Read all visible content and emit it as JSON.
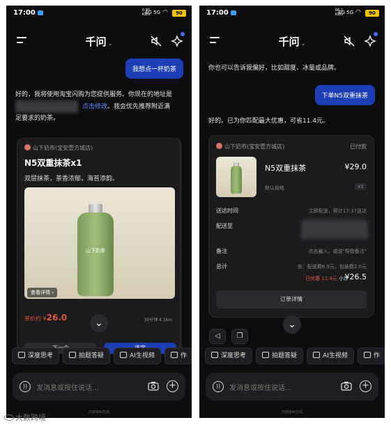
{
  "status_left": {
    "time": "17:00",
    "speed_value": "0.80",
    "speed_unit": "KB/s",
    "network": "4G 5G",
    "battery": "90"
  },
  "status_right": {
    "time": "17:00",
    "speed_value": "68.2",
    "speed_unit": "KB/s",
    "network": "4G 5G",
    "battery": "90"
  },
  "app_title": "千问",
  "left": {
    "user_message": "我想点一杯奶茶",
    "ai_line1": "好的，我将使用淘宝闪购为您提供服务。你现在的地址是",
    "ai_link": "点击修改",
    "ai_line2_tail": "。我会优先推荐附近满",
    "ai_line3": "足要求的奶茶。",
    "card": {
      "shop": "山下奶市(宝安壹方城店)",
      "product": "N5双重抹茶x1",
      "description": "双层抹茶，茶香浓郁，海苔添韵。",
      "bottle_text": "山下奶茶",
      "view_detail": "查看详情 ›",
      "price_prefix": "单价约 ¥",
      "price": "26.0",
      "eta": "30分钟 4.1km",
      "next_button": "下一个",
      "order_button": "选定"
    }
  },
  "right": {
    "ai_top": "你也可以告诉我偏好，比如甜度、冰量或品牌。",
    "user_message": "下单N5双重抹茶",
    "ai_reply": "好的。已为你匹配最大优惠，可省11.4元。",
    "card": {
      "shop": "山下奶市(宝安壹方城店)",
      "status": "已付款",
      "product": "N5双重抹茶",
      "price": "¥29.0",
      "spec": "默认规格",
      "qty": "x1",
      "delivery_time_label": "送达时间",
      "delivery_time_value": "立即配送，预计17:37送达",
      "deliver_to_label": "配送至",
      "note_label": "备注",
      "note_value": "点击输入，或说\"帮我备注\"",
      "total_label": "总计",
      "fees": "含：配送费6.9元，包装费2.0元",
      "discount": "已优惠 11.4元",
      "subtotal_label": "小计",
      "subtotal": "¥26.5",
      "details_button": "订单详情"
    }
  },
  "chips": [
    {
      "label": "深度思考",
      "icon": "atom-icon"
    },
    {
      "label": "拍题答疑",
      "icon": "camera-icon"
    },
    {
      "label": "AI生视频",
      "icon": "video-icon"
    },
    {
      "label": "作",
      "icon": "image-icon"
    }
  ],
  "input_placeholder": "发消息或按住说话...",
  "disclaimer": "内容由AI生成",
  "watermark": "大数跨境",
  "colors": {
    "bg": "#0d0d0f",
    "user_bubble": "#1d3fb5",
    "link": "#5b8cff",
    "price": "#e0583c"
  }
}
